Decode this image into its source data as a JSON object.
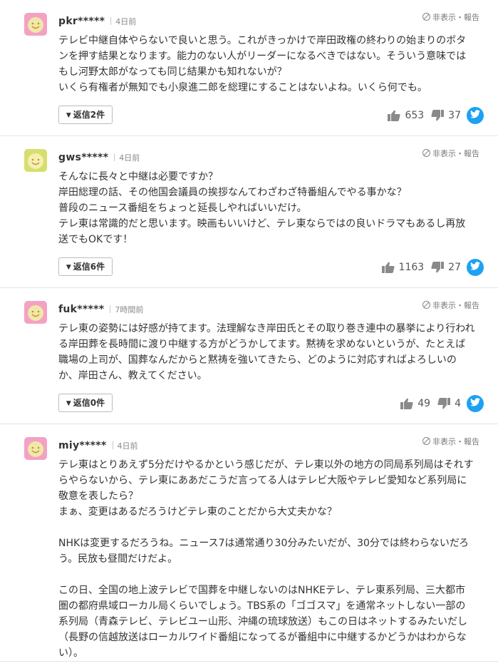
{
  "ui": {
    "hide_report": "非表示・報告",
    "reply_prefix": "返信",
    "reply_suffix": "件"
  },
  "comments": [
    {
      "user": "pkr*****",
      "time": "4日前",
      "avatar_color": "#f3a1c4",
      "avatar_face": "#f0e8a8",
      "lines": [
        "テレビ中継自体やらないで良いと思う。これがきっかけで岸田政権の終わりの始まりのボタンを押す結果となります。能力のない人がリーダーになるべきではない。そういう意味ではもし河野太郎がなっても同じ結果かも知れないが？",
        "いくら有権者が無知でも小泉進二郎を総理にすることはないよね。いくら何でも。"
      ],
      "replies": "2",
      "likes": "653",
      "dislikes": "37"
    },
    {
      "user": "gws*****",
      "time": "4日前",
      "avatar_color": "#d6df6e",
      "avatar_face": "#f4f0b0",
      "lines": [
        "そんなに長々と中継は必要ですか？",
        "岸田総理の話、その他国会議員の挨拶なんてわざわざ特番組んでやる事かな？",
        "普段のニュース番組をちょっと延長しやればいいだけ。",
        "テレ東は常識的だと思います。映画もいいけど、テレ東ならではの良いドラマもあるし再放送でもOKです！"
      ],
      "replies": "6",
      "likes": "1163",
      "dislikes": "27"
    },
    {
      "user": "fuk*****",
      "time": "7時間前",
      "avatar_color": "#f3a1c4",
      "avatar_face": "#f0e8a8",
      "lines": [
        "テレ東の姿勢には好感が持てます。法理解なき岸田氏とその取り巻き連中の暴挙により行われる岸田葬を長時間に渡り中継する方がどうかしてます。黙祷を求めないというが、たとえば職場の上司が、国葬なんだからと黙祷を強いてきたら、どのように対応すればよろしいのか、岸田さん、教えてください。"
      ],
      "replies": "0",
      "likes": "49",
      "dislikes": "4"
    },
    {
      "user": "miy*****",
      "time": "4日前",
      "avatar_color": "#f3a1c4",
      "avatar_face": "#f0e8a8",
      "lines": [
        "テレ東はとりあえず5分だけやるかという感じだが、テレ東以外の地方の同局系列局はそれすらやらないから、テレ東にああだこうだ言ってる人はテレビ大阪やテレビ愛知など系列局に敬意を表したら？",
        "まぁ、変更はあるだろうけどテレ東のことだから大丈夫かな？",
        "",
        "NHKは変更するだろうね。ニュース7は通常通り30分みたいだが、30分では終わらないだろう。民放も昼間だけだよ。",
        "",
        "この日、全国の地上波テレビで国葬を中継しないのはNHKEテレ、テレ東系列局、三大都市圏の都府県域ローカル局くらいでしょう。TBS系の「ゴゴスマ」を通常ネットしない一部の系列局（青森テレビ、テレビユー山形、沖縄の琉球放送）もこの日はネットするみたいだし（長野の信越放送はローカルワイド番組になってるが番組中に中継するかどうかはわからない）。"
      ],
      "replies": "",
      "likes": "",
      "dislikes": ""
    }
  ]
}
